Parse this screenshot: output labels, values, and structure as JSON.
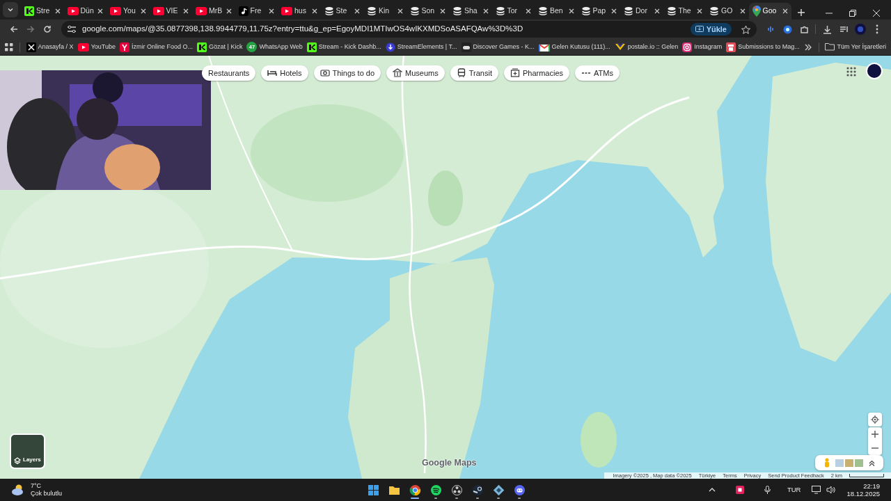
{
  "tabs": [
    {
      "title": "Stre",
      "kind": "kick",
      "selected": false
    },
    {
      "title": "Dün",
      "kind": "youtube",
      "selected": false
    },
    {
      "title": "You",
      "kind": "youtube",
      "selected": false
    },
    {
      "title": "VIE",
      "kind": "youtube",
      "selected": false
    },
    {
      "title": "MrB",
      "kind": "youtube",
      "selected": false
    },
    {
      "title": "Fre",
      "kind": "tiktok",
      "selected": false
    },
    {
      "title": "hus",
      "kind": "youtube",
      "selected": false
    },
    {
      "title": "Ste",
      "kind": "stack",
      "selected": false
    },
    {
      "title": "Kin",
      "kind": "stack",
      "selected": false
    },
    {
      "title": "Son",
      "kind": "stack",
      "selected": false
    },
    {
      "title": "Sha",
      "kind": "stack",
      "selected": false
    },
    {
      "title": "Tor",
      "kind": "stack",
      "selected": false
    },
    {
      "title": "Ben",
      "kind": "stack",
      "selected": false
    },
    {
      "title": "Pap",
      "kind": "stack",
      "selected": false
    },
    {
      "title": "Dor",
      "kind": "stack",
      "selected": false
    },
    {
      "title": "The",
      "kind": "stack",
      "selected": false
    },
    {
      "title": "GO",
      "kind": "stack",
      "selected": false
    },
    {
      "title": "Goo",
      "kind": "maps",
      "selected": true
    }
  ],
  "address": {
    "url": "google.com/maps/@35.0877398,138.9944779,11.75z?entry=ttu&g_ep=EgoyMDI1MTIwOS4wIKXMDSoASAFQAw%3D%3D",
    "install_label": "Yükle"
  },
  "bookmarks": [
    {
      "label": "Anasayfa / X",
      "kind": "x"
    },
    {
      "label": "YouTube",
      "kind": "youtube"
    },
    {
      "label": "İzmir Online Food O...",
      "kind": "food"
    },
    {
      "label": "Gözat | Kick",
      "kind": "kick"
    },
    {
      "label": "WhatsApp Web",
      "kind": "whatsapp",
      "badge": "47"
    },
    {
      "label": "Stream - Kick Dashb...",
      "kind": "kick"
    },
    {
      "label": "StreamElements | T...",
      "kind": "se"
    },
    {
      "label": "Discover Games - K...",
      "kind": "games"
    },
    {
      "label": "Gelen Kutusu (111)...",
      "kind": "mail"
    },
    {
      "label": "postale.io :: Gelen",
      "kind": "postale"
    },
    {
      "label": "Instagram",
      "kind": "instagram"
    },
    {
      "label": "Submissions to Mag...",
      "kind": "shop"
    }
  ],
  "all_bookmarks": "Tüm Yer İşaretleri",
  "map": {
    "categories": [
      {
        "label": "Restaurants",
        "kind": "plain"
      },
      {
        "label": "Hotels",
        "kind": "bed"
      },
      {
        "label": "Things to do",
        "kind": "camera"
      },
      {
        "label": "Museums",
        "kind": "museum"
      },
      {
        "label": "Transit",
        "kind": "bus"
      },
      {
        "label": "Pharmacies",
        "kind": "pharmacy"
      },
      {
        "label": "ATMs",
        "kind": "atm"
      }
    ],
    "layers_label": "Layers",
    "logo": "Google Maps",
    "attribution": "Imagery ©2025 , Map data ©2025",
    "footer_links": [
      "Türkiye",
      "Terms",
      "Privacy",
      "Send Product Feedback"
    ],
    "scale": "2 km"
  },
  "taskbar": {
    "temperature": "7°C",
    "weather": "Çok bulutlu",
    "apps": [
      {
        "kind": "windows",
        "active": false,
        "running": false
      },
      {
        "kind": "folder",
        "active": false,
        "running": false
      },
      {
        "kind": "chrome",
        "active": true,
        "running": true
      },
      {
        "kind": "spotify",
        "active": false,
        "running": true
      },
      {
        "kind": "obs",
        "active": false,
        "running": true
      },
      {
        "kind": "steam",
        "active": false,
        "running": true
      },
      {
        "kind": "app",
        "active": false,
        "running": true
      },
      {
        "kind": "discord",
        "active": false,
        "running": true
      }
    ],
    "language": "TUR",
    "time": "22:19",
    "date": "18.12.2025"
  }
}
